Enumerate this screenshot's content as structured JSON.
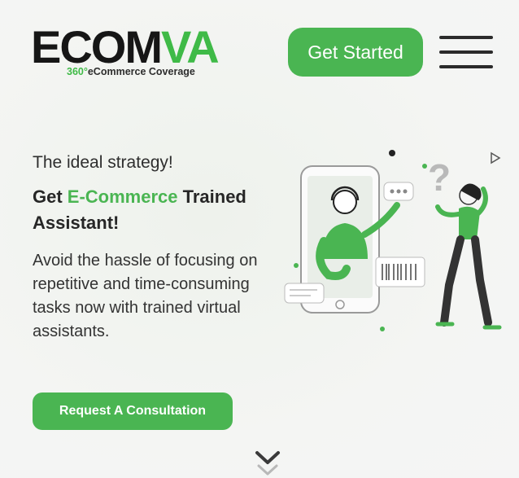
{
  "header": {
    "logo_dark": "ECOM",
    "logo_accent": "VA",
    "tagline_num": "360°",
    "tagline_text": "eCommerce Coverage",
    "cta_label": "Get Started",
    "menu_icon": "hamburger-menu-icon"
  },
  "hero": {
    "eyebrow": "The ideal strategy!",
    "headline_pre": "Get ",
    "headline_accent": "E-Commerce",
    "headline_post": " Trained Assistant!",
    "description": "Avoid the hassle of focusing on repetitive and time-consuming tasks now with trained virtual assistants.",
    "button_label": "Request A Consultation",
    "scroll_icon": "chevron-down-icon"
  },
  "colors": {
    "accent": "#4ab552",
    "text_dark": "#262626",
    "background": "#f3f4f2"
  }
}
